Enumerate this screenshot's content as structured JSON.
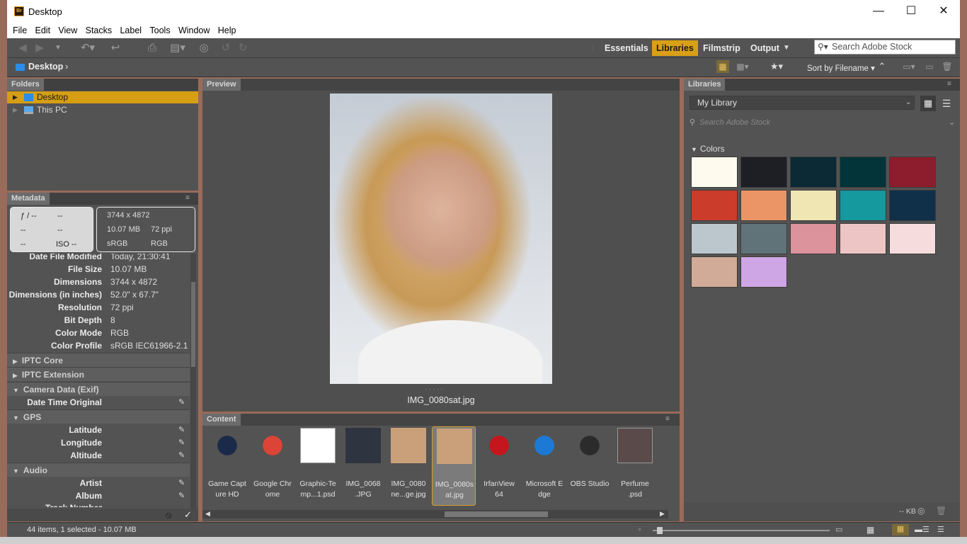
{
  "window": {
    "title": "Desktop",
    "minimize": "—",
    "maximize": "☐",
    "close": "✕"
  },
  "menu": [
    "File",
    "Edit",
    "View",
    "Stacks",
    "Label",
    "Tools",
    "Window",
    "Help"
  ],
  "workspaces": [
    "Essentials",
    "Libraries",
    "Filmstrip",
    "Output"
  ],
  "active_workspace": "Libraries",
  "stock_search": {
    "placeholder": "Search Adobe Stock"
  },
  "path": {
    "current": "Desktop"
  },
  "sort": {
    "label": "Sort by Filename"
  },
  "folders": {
    "tab": "Folders",
    "items": [
      {
        "label": "Desktop",
        "selected": true
      },
      {
        "label": "This PC",
        "selected": false
      }
    ]
  },
  "metadata": {
    "tab": "Metadata",
    "camera": {
      "aperture": "ƒ / --",
      "shutter": "--",
      "a": "--",
      "b": "--",
      "c": "--",
      "iso": "ISO --"
    },
    "file": {
      "dimensions": "3744 x 4872",
      "size": "10.07 MB",
      "ppi": "72 ppi",
      "profile": "sRGB",
      "mode": "RGB"
    },
    "rows": [
      {
        "k": "Date File Modified",
        "v": "Today, 21:30:41"
      },
      {
        "k": "File Size",
        "v": "10.07 MB"
      },
      {
        "k": "Dimensions",
        "v": "3744 x 4872"
      },
      {
        "k": "Dimensions (in inches)",
        "v": "52.0\" x 67.7\""
      },
      {
        "k": "Resolution",
        "v": "72 ppi"
      },
      {
        "k": "Bit Depth",
        "v": "8"
      },
      {
        "k": "Color Mode",
        "v": "RGB"
      },
      {
        "k": "Color Profile",
        "v": "sRGB IEC61966-2.1"
      }
    ],
    "sections": {
      "iptc_core": "IPTC Core",
      "iptc_ext": "IPTC Extension",
      "camera_data": "Camera Data (Exif)",
      "gps": "GPS",
      "audio": "Audio"
    },
    "exif_rows": [
      "Date Time Original"
    ],
    "gps_rows": [
      "Latitude",
      "Longitude",
      "Altitude"
    ],
    "audio_rows": [
      "Artist",
      "Album",
      "Track Number"
    ]
  },
  "preview": {
    "tab": "Preview",
    "filename": "IMG_0080sat.jpg"
  },
  "content": {
    "tab": "Content",
    "items": [
      {
        "l1": "Game Capt",
        "l2": "ure HD",
        "icon": "app-shortcut",
        "color": "#1b2a4a"
      },
      {
        "l1": "Google Chr",
        "l2": "ome",
        "icon": "chrome",
        "color": "#db4437"
      },
      {
        "l1": "Graphic-Te",
        "l2": "mp...1.psd",
        "icon": "psd",
        "color": "#ffffff"
      },
      {
        "l1": "IMG_0068",
        "l2": ".JPG",
        "icon": "photo",
        "color": "#2e3440"
      },
      {
        "l1": "IMG_0080",
        "l2": "ne...ge.jpg",
        "icon": "photo",
        "color": "#caa07a"
      },
      {
        "l1": "IMG_0080s",
        "l2": "at.jpg",
        "icon": "photo",
        "color": "#caa07a",
        "selected": true
      },
      {
        "l1": "IrfanView",
        "l2": "64",
        "icon": "irfanview",
        "color": "#c4161c"
      },
      {
        "l1": "Microsoft E",
        "l2": "dge",
        "icon": "edge",
        "color": "#1c7ad6"
      },
      {
        "l1": "OBS Studio",
        "l2": "",
        "icon": "obs",
        "color": "#2b2b2b"
      },
      {
        "l1": "Perfume",
        "l2": ".psd",
        "icon": "psd",
        "color": "#5a4a4a"
      }
    ]
  },
  "libraries": {
    "tab": "Libraries",
    "selected_library": "My Library",
    "search_placeholder": "Search Adobe Stock",
    "colors_label": "Colors",
    "swatches": [
      "#fefbee",
      "#1e1f25",
      "#0b2a35",
      "#033439",
      "#8d1d2c",
      "#cc3c2b",
      "#eb9567",
      "#f0e6b3",
      "#15989e",
      "#10304a",
      "#bcc7cd",
      "#607379",
      "#dc939b",
      "#eec5c5",
      "#f7dcdd",
      "#d2aa98",
      "#cfa6e5"
    ],
    "footer_size": "-- KB"
  },
  "status": {
    "text": "44 items, 1 selected - 10.07 MB"
  }
}
